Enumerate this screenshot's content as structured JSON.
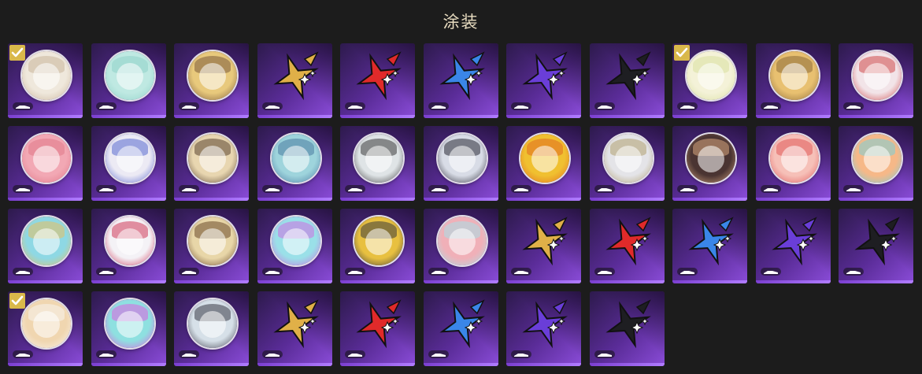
{
  "title": "涂装",
  "skins": [
    {
      "kind": "portrait",
      "bg": "#efe8dc",
      "accent": "#c9b49a",
      "selected": true
    },
    {
      "kind": "portrait",
      "bg": "#bfe9e2",
      "accent": "#8fd1c8",
      "selected": false
    },
    {
      "kind": "portrait",
      "bg": "#e8c97c",
      "accent": "#7a5a3a",
      "selected": false
    },
    {
      "kind": "star",
      "color": "#e0b048",
      "selected": false
    },
    {
      "kind": "star",
      "color": "#e02a2a",
      "selected": false
    },
    {
      "kind": "star",
      "color": "#3a86e8",
      "selected": false
    },
    {
      "kind": "star",
      "color": "#6a3ed8",
      "selected": false
    },
    {
      "kind": "star",
      "color": "#1e1e22",
      "selected": false
    },
    {
      "kind": "portrait",
      "bg": "#f4f2d8",
      "accent": "#d9e0a0",
      "selected": true
    },
    {
      "kind": "portrait",
      "bg": "#e8c070",
      "accent": "#8a6a38",
      "selected": false
    },
    {
      "kind": "portrait",
      "bg": "#f2e4e8",
      "accent": "#d04a4a",
      "selected": false
    },
    {
      "kind": "portrait",
      "bg": "#f2a8b4",
      "accent": "#e07888",
      "selected": false
    },
    {
      "kind": "portrait",
      "bg": "#eceaf4",
      "accent": "#5a6ad0",
      "selected": false
    },
    {
      "kind": "portrait",
      "bg": "#e8d6b0",
      "accent": "#5a4632",
      "selected": false
    },
    {
      "kind": "portrait",
      "bg": "#9ed4dc",
      "accent": "#4a7aa0",
      "selected": false
    },
    {
      "kind": "portrait",
      "bg": "#dfe4e6",
      "accent": "#3a3a3a",
      "selected": false
    },
    {
      "kind": "portrait",
      "bg": "#d8dce6",
      "accent": "#2a2a34",
      "selected": false
    },
    {
      "kind": "portrait",
      "bg": "#f0c030",
      "accent": "#e06a20",
      "selected": false
    },
    {
      "kind": "portrait",
      "bg": "#e4e4e8",
      "accent": "#b0a070",
      "selected": false
    },
    {
      "kind": "portrait",
      "bg": "#4a3432",
      "accent": "#d8a880",
      "selected": false
    },
    {
      "kind": "portrait",
      "bg": "#f6c0b8",
      "accent": "#e05a5a",
      "selected": false
    },
    {
      "kind": "portrait",
      "bg": "#f6b888",
      "accent": "#7ad0d8",
      "selected": false
    },
    {
      "kind": "portrait",
      "bg": "#8ed8e4",
      "accent": "#e8c060",
      "selected": false
    },
    {
      "kind": "portrait",
      "bg": "#f4f2f6",
      "accent": "#d03a5a",
      "selected": false
    },
    {
      "kind": "portrait",
      "bg": "#e8d6a8",
      "accent": "#6a4a2a",
      "selected": false
    },
    {
      "kind": "portrait",
      "bg": "#9ae0e8",
      "accent": "#d070e0",
      "selected": false
    },
    {
      "kind": "portrait",
      "bg": "#e8c040",
      "accent": "#3a3a3a",
      "selected": false
    },
    {
      "kind": "portrait",
      "bg": "#f0b0b8",
      "accent": "#a8e0e8",
      "selected": false
    },
    {
      "kind": "star",
      "color": "#e0b048",
      "selected": false
    },
    {
      "kind": "star",
      "color": "#e02a2a",
      "selected": false
    },
    {
      "kind": "star",
      "color": "#3a86e8",
      "selected": false
    },
    {
      "kind": "star",
      "color": "#6a3ed8",
      "selected": false
    },
    {
      "kind": "star",
      "color": "#1e1e22",
      "selected": false
    },
    {
      "kind": "portrait",
      "bg": "#f0d6b0",
      "accent": "#f8f4ee",
      "selected": true
    },
    {
      "kind": "portrait",
      "bg": "#8ee0e0",
      "accent": "#e060e0",
      "selected": false
    },
    {
      "kind": "portrait",
      "bg": "#d6e0e8",
      "accent": "#3a3a46",
      "selected": false
    },
    {
      "kind": "star",
      "color": "#e0b048",
      "selected": false
    },
    {
      "kind": "star",
      "color": "#e02a2a",
      "selected": false
    },
    {
      "kind": "star",
      "color": "#3a86e8",
      "selected": false
    },
    {
      "kind": "star",
      "color": "#6a3ed8",
      "selected": false
    },
    {
      "kind": "star",
      "color": "#1e1e22",
      "selected": false
    }
  ]
}
